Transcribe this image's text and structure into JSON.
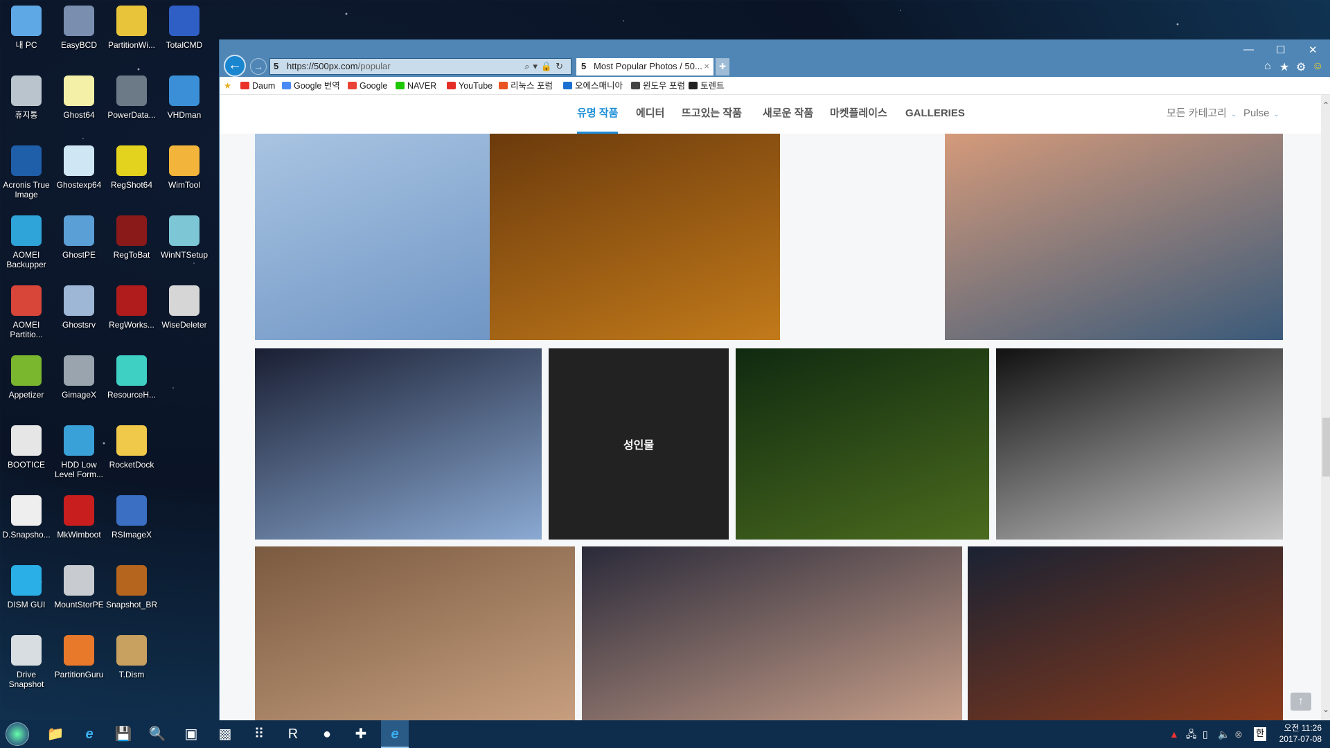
{
  "desktop": {
    "icons": [
      {
        "label": "내 PC",
        "color": "#5fa8e6"
      },
      {
        "label": "EasyBCD",
        "color": "#7a8fb0"
      },
      {
        "label": "PartitionWi...",
        "color": "#e8c43a"
      },
      {
        "label": "TotalCMD",
        "color": "#2f5fc4"
      },
      {
        "label": "휴지통",
        "color": "#b9c4cc"
      },
      {
        "label": "Ghost64",
        "color": "#f4f0a8"
      },
      {
        "label": "PowerData...",
        "color": "#6c7a88"
      },
      {
        "label": "VHDman",
        "color": "#3a8fd6"
      },
      {
        "label": "Acronis True Image",
        "color": "#1f5ea8"
      },
      {
        "label": "Ghostexp64",
        "color": "#cfe6f5"
      },
      {
        "label": "RegShot64",
        "color": "#e3d21e"
      },
      {
        "label": "WimTool",
        "color": "#f2b43a"
      },
      {
        "label": "AOMEI Backupper",
        "color": "#2ea4d8"
      },
      {
        "label": "GhostPE",
        "color": "#5a9fd6"
      },
      {
        "label": "RegToBat",
        "color": "#8a1a1a"
      },
      {
        "label": "WinNTSetup",
        "color": "#7cc6d6"
      },
      {
        "label": "AOMEI Partitio...",
        "color": "#d8463a"
      },
      {
        "label": "Ghostsrv",
        "color": "#9fb7d6"
      },
      {
        "label": "RegWorks...",
        "color": "#b01c1c"
      },
      {
        "label": "WiseDeleter",
        "color": "#d6d6d6"
      },
      {
        "label": "Appetizer",
        "color": "#7ab62e"
      },
      {
        "label": "GimageX",
        "color": "#9aa4ae"
      },
      {
        "label": "ResourceH...",
        "color": "#3fd0c4"
      },
      {
        "label": "BOOTICE",
        "color": "#e6e6e6"
      },
      {
        "label": "HDD Low Level Form...",
        "color": "#3aa0d8"
      },
      {
        "label": "RocketDock",
        "color": "#f0c94a"
      },
      {
        "label": "D.Snapsho...",
        "color": "#eeeeee"
      },
      {
        "label": "MkWimboot",
        "color": "#c81e1e"
      },
      {
        "label": "RSImageX",
        "color": "#3a6fc4"
      },
      {
        "label": "DISM GUI",
        "color": "#2ab0e6"
      },
      {
        "label": "MountStorPE",
        "color": "#c8ccd0"
      },
      {
        "label": "Snapshot_BR",
        "color": "#b5651d"
      },
      {
        "label": "Drive Snapshot",
        "color": "#d8dde2"
      },
      {
        "label": "PartitionGuru",
        "color": "#e8782a"
      },
      {
        "label": "T.Dism",
        "color": "#c8a060"
      }
    ]
  },
  "browser": {
    "address": {
      "host": "https://500px.com",
      "path": "/popular",
      "favicon": "5"
    },
    "tab": {
      "title": "Most Popular Photos / 50...",
      "favicon": "5",
      "close": "×"
    },
    "new_tab": "✚",
    "window_controls": {
      "minimize": "—",
      "maximize": "☐",
      "close": "✕"
    },
    "toolbar_icons": {
      "home": "⌂",
      "favorites": "★",
      "settings": "⚙",
      "feedback": "☺"
    },
    "address_tools": "⌕▾🔒↻",
    "favorites": [
      {
        "label": "Daum",
        "icon": "#e8322a"
      },
      {
        "label": "Google 번역",
        "icon": "#4a8af4"
      },
      {
        "label": "Google",
        "icon": "#ea4335"
      },
      {
        "label": "NAVER",
        "icon": "#1ec800"
      },
      {
        "label": "YouTube",
        "icon": "#e52d27"
      },
      {
        "label": "리눅스 포럼",
        "icon": "#e95420"
      },
      {
        "label": "오에스매니아",
        "icon": "#1a6fd0"
      },
      {
        "label": "윈도우 포럼",
        "icon": "#444444"
      },
      {
        "label": "토렌트",
        "icon": "#222222"
      }
    ]
  },
  "site": {
    "nav": [
      {
        "label": "유명 작품",
        "active": true
      },
      {
        "label": "에디터"
      },
      {
        "label": "뜨고있는 작품"
      },
      {
        "label": "새로운 작품"
      },
      {
        "label": "마켓플레이스"
      },
      {
        "label": "GALLERIES"
      }
    ],
    "filters": {
      "category": "모든 카테고리",
      "sort": "Pulse",
      "caret": "⌄"
    },
    "photos": [
      {
        "subject": "daisies",
        "colors": [
          "#a9c4e2",
          "#6c93c3"
        ]
      },
      {
        "subject": "rhino",
        "colors": [
          "#6b3a0c",
          "#c27a1a"
        ]
      },
      {
        "subject": "pier-seascape",
        "colors": [
          "#d59a7a",
          "#3a5a7a"
        ]
      },
      {
        "subject": "flowers-on-leaf",
        "colors": [
          "#1a1f33",
          "#8aa9d2"
        ]
      },
      {
        "subject": "adult-content",
        "label": "성인물"
      },
      {
        "subject": "bee",
        "colors": [
          "#0f2a10",
          "#4a6b1e"
        ]
      },
      {
        "subject": "architecture",
        "colors": [
          "#111111",
          "#c8c8c8"
        ]
      },
      {
        "subject": "monkeys",
        "colors": [
          "#7a5a40",
          "#c8a080"
        ]
      },
      {
        "subject": "mountains",
        "colors": [
          "#2a2a3a",
          "#c9a08a"
        ]
      },
      {
        "subject": "woman-flowers",
        "colors": [
          "#1a2233",
          "#8a3a1a"
        ]
      }
    ],
    "scroll_to_top": "↑",
    "scroll_up": "⌃",
    "scroll_down": "⌄"
  },
  "taskbar": {
    "apps": [
      {
        "name": "file-explorer",
        "glyph": "📁"
      },
      {
        "name": "internet-explorer",
        "glyph": "e"
      },
      {
        "name": "totalcmd",
        "glyph": "💾"
      },
      {
        "name": "search-tool",
        "glyph": "🔍"
      },
      {
        "name": "transformer-app",
        "glyph": "▣"
      },
      {
        "name": "color-monitor",
        "glyph": "▩"
      },
      {
        "name": "network-grid",
        "glyph": "⠿"
      },
      {
        "name": "rocketdock",
        "glyph": "R"
      },
      {
        "name": "appetizer",
        "glyph": "●"
      },
      {
        "name": "tools-app",
        "glyph": "✚"
      },
      {
        "name": "internet-explorer-active",
        "glyph": "e"
      }
    ],
    "tray": {
      "ime": "한"
    },
    "clock": {
      "time": "오전 11:26",
      "date": "2017-07-08"
    }
  }
}
